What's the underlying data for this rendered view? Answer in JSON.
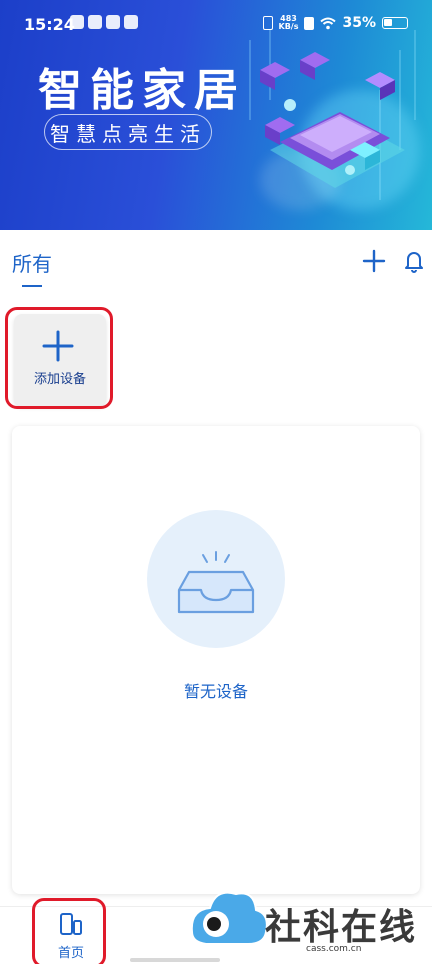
{
  "status_bar": {
    "time": "15:24",
    "net_speed_value": "483",
    "net_speed_unit": "KB/s",
    "battery": "35%"
  },
  "banner": {
    "title": "智能家居",
    "subtitle": "智慧点亮生活"
  },
  "tabs": {
    "all_label": "所有"
  },
  "add_device": {
    "label": "添加设备"
  },
  "empty_state": {
    "message": "暂无设备"
  },
  "bottom_nav": {
    "home_label": "首页"
  },
  "watermark": {
    "text": "社科在线",
    "url": "cass.com.cn"
  },
  "colors": {
    "accent": "#1e64c8",
    "highlight_frame": "#e01a2a",
    "banner_start": "#1c3fc9",
    "banner_end": "#25b8d8"
  },
  "icons": [
    "plus-icon",
    "bell-icon",
    "tray-icon",
    "phone-device-icon",
    "wifi-icon",
    "battery-icon"
  ]
}
